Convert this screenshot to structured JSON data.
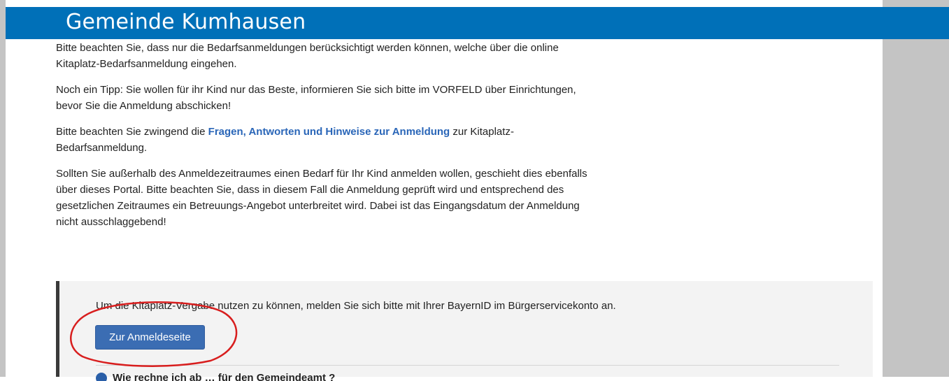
{
  "header": {
    "title": "Gemeinde Kumhausen"
  },
  "main": {
    "paragraph_1": "Bitte beachten Sie, dass nur die Bedarfsanmeldungen berücksichtigt werden können, welche über die online Kitaplatz-Bedarfsanmeldung eingehen.",
    "paragraph_2": "Noch ein Tipp: Sie wollen für ihr Kind nur das Beste, informieren Sie sich bitte im VORFELD über Einrichtungen, bevor Sie die Anmeldung abschicken!",
    "paragraph_3_before": "Bitte beachten Sie zwingend die ",
    "paragraph_3_link": "Fragen, Antworten und Hinweise zur Anmeldung",
    "paragraph_3_after": " zur Kitaplatz-Bedarfsanmeldung.",
    "paragraph_4": "Sollten Sie außerhalb des Anmeldezeitraumes einen Bedarf für Ihr Kind anmelden wollen, geschieht dies ebenfalls über dieses Portal. Bitte beachten Sie, dass in diesem Fall die Anmeldung geprüft wird und entsprechend des gesetzlichen Zeitraumes ein Betreuungs-Angebot unterbreitet wird. Dabei ist das Eingangsdatum der Anmeldung nicht ausschlaggebend!"
  },
  "login_box": {
    "message": "Um die Kitaplatz-Vergabe nutzen zu können, melden Sie sich bitte mit Ihrer BayernID im Bürgerservicekonto an.",
    "button_label": "Zur Anmeldeseite",
    "cut_off_heading": "Wie rechne ich ab … für den Gemeindeamt ?"
  },
  "colors": {
    "header_blue": "#0070b8",
    "link_blue": "#2a66b8",
    "button_blue": "#3b6db3",
    "highlight_red": "#d81e1e",
    "side_gray": "#c4c4c4",
    "box_gray": "#f3f3f3"
  },
  "icons": {
    "info_bullet": "info-circle-icon"
  }
}
